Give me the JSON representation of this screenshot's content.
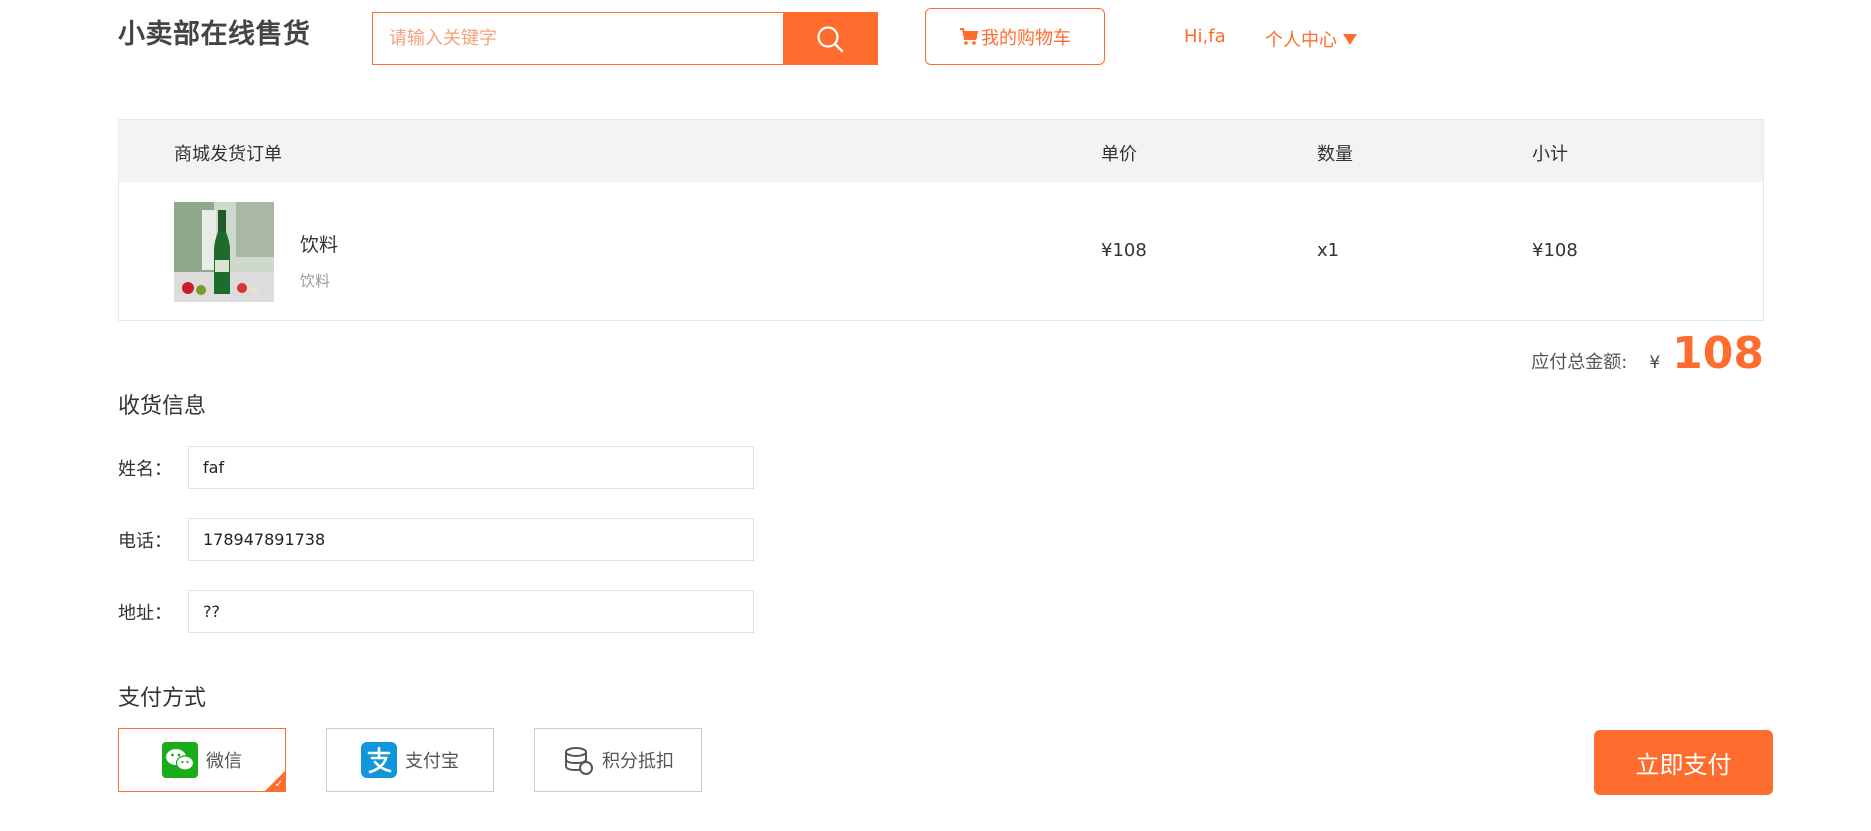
{
  "header": {
    "logo": "小卖部在线售货",
    "search": {
      "placeholder": "请输入关键字",
      "value": ""
    },
    "cart_label": "我的购物车",
    "greeting": "Hi,fa",
    "user_center": "个人中心"
  },
  "order": {
    "title": "商城发货订单",
    "columns": {
      "price": "单价",
      "qty": "数量",
      "subtotal": "小计"
    },
    "items": [
      {
        "name": "饮料",
        "spec": "饮料",
        "price": "¥108",
        "qty": "x1",
        "subtotal": "¥108"
      }
    ],
    "total_label": "应付总金额:",
    "currency": "¥",
    "total_amount": "108"
  },
  "shipping": {
    "title": "收货信息",
    "fields": [
      {
        "label": "姓名：",
        "value": "faf"
      },
      {
        "label": "电话：",
        "value": "178947891738"
      },
      {
        "label": "地址：",
        "value": "??"
      }
    ]
  },
  "payment": {
    "title": "支付方式",
    "options": [
      {
        "label": "微信",
        "icon": "wechat-icon",
        "selected": true
      },
      {
        "label": "支付宝",
        "icon": "alipay-icon",
        "selected": false
      },
      {
        "label": "积分抵扣",
        "icon": "coins-icon",
        "selected": false
      }
    ],
    "pay_now": "立即支付"
  },
  "colors": {
    "accent": "#ff6d2e",
    "header_bg": "#f3f3f3",
    "wechat": "#1aad19",
    "alipay": "#1296db"
  }
}
